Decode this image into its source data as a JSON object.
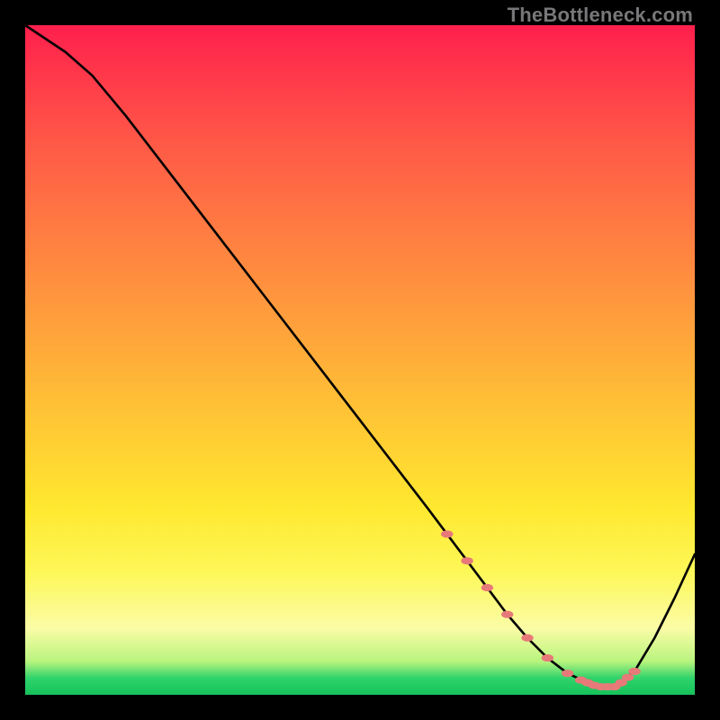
{
  "watermark": "TheBottleneck.com",
  "chart_data": {
    "type": "line",
    "title": "",
    "xlabel": "",
    "ylabel": "",
    "xlim": [
      0,
      100
    ],
    "ylim": [
      0,
      100
    ],
    "grid": false,
    "legend": false,
    "series": [
      {
        "name": "bottleneck-curve",
        "color": "#000000",
        "x": [
          0,
          3,
          6,
          10,
          15,
          20,
          25,
          30,
          35,
          40,
          45,
          50,
          55,
          60,
          63,
          66,
          69,
          72,
          75,
          78,
          81,
          84,
          86,
          88,
          91,
          94,
          97,
          100
        ],
        "y": [
          100,
          98,
          96,
          92.5,
          86.5,
          80,
          73.5,
          67,
          60.5,
          54,
          47.5,
          41,
          34.5,
          28,
          24,
          20,
          16,
          12,
          8.5,
          5.5,
          3.2,
          1.8,
          1.2,
          1.2,
          3.5,
          8.5,
          14.5,
          21
        ]
      }
    ],
    "markers": {
      "name": "highlight-segment",
      "color": "#e77a79",
      "x": [
        63,
        66,
        69,
        72,
        75,
        78,
        81,
        83,
        84,
        85,
        86,
        87,
        88,
        89,
        90,
        91
      ],
      "y": [
        24,
        20,
        16,
        12,
        8.5,
        5.5,
        3.2,
        2.2,
        1.8,
        1.4,
        1.2,
        1.2,
        1.2,
        1.8,
        2.6,
        3.5
      ]
    }
  }
}
